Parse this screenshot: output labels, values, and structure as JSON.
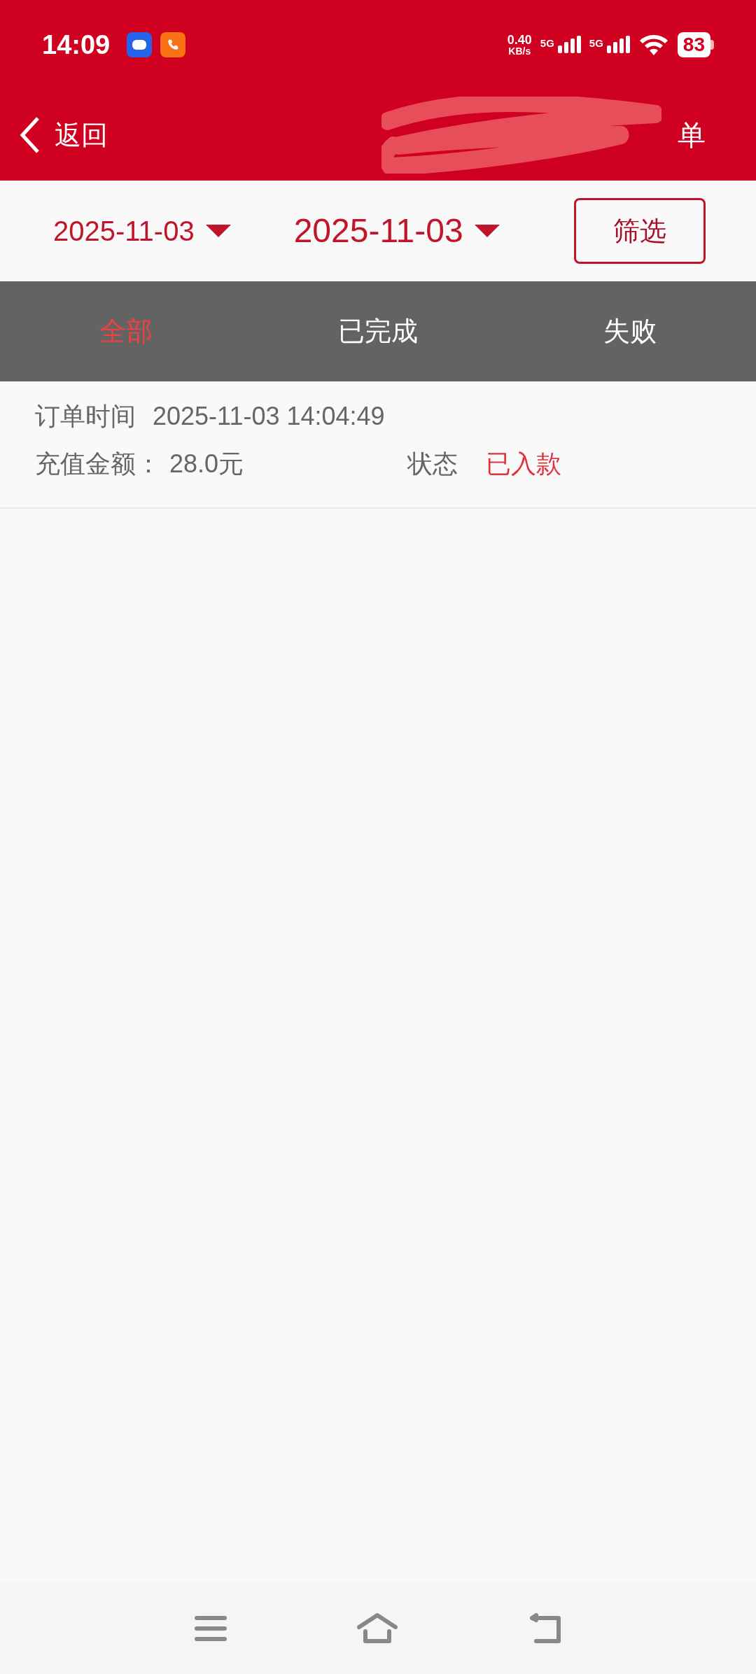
{
  "status_bar": {
    "time": "14:09",
    "speed": "0.40",
    "speed_unit": "KB/s",
    "sim1": "5G",
    "sim2": "5G",
    "battery": "83"
  },
  "nav": {
    "back": "返回",
    "title": "单"
  },
  "filter": {
    "start_date": "2025-11-03",
    "end_date": "2025-11-03",
    "button": "筛选"
  },
  "tabs": [
    {
      "label": "全部",
      "selected": true
    },
    {
      "label": "已完成",
      "selected": false
    },
    {
      "label": "失败",
      "selected": false
    }
  ],
  "orders": [
    {
      "time_label": "订单时间",
      "time": "2025-11-03 14:04:49",
      "amount_label": "充值金额：",
      "amount": "28.0元",
      "status_label": "状态",
      "status": "已入款"
    }
  ]
}
